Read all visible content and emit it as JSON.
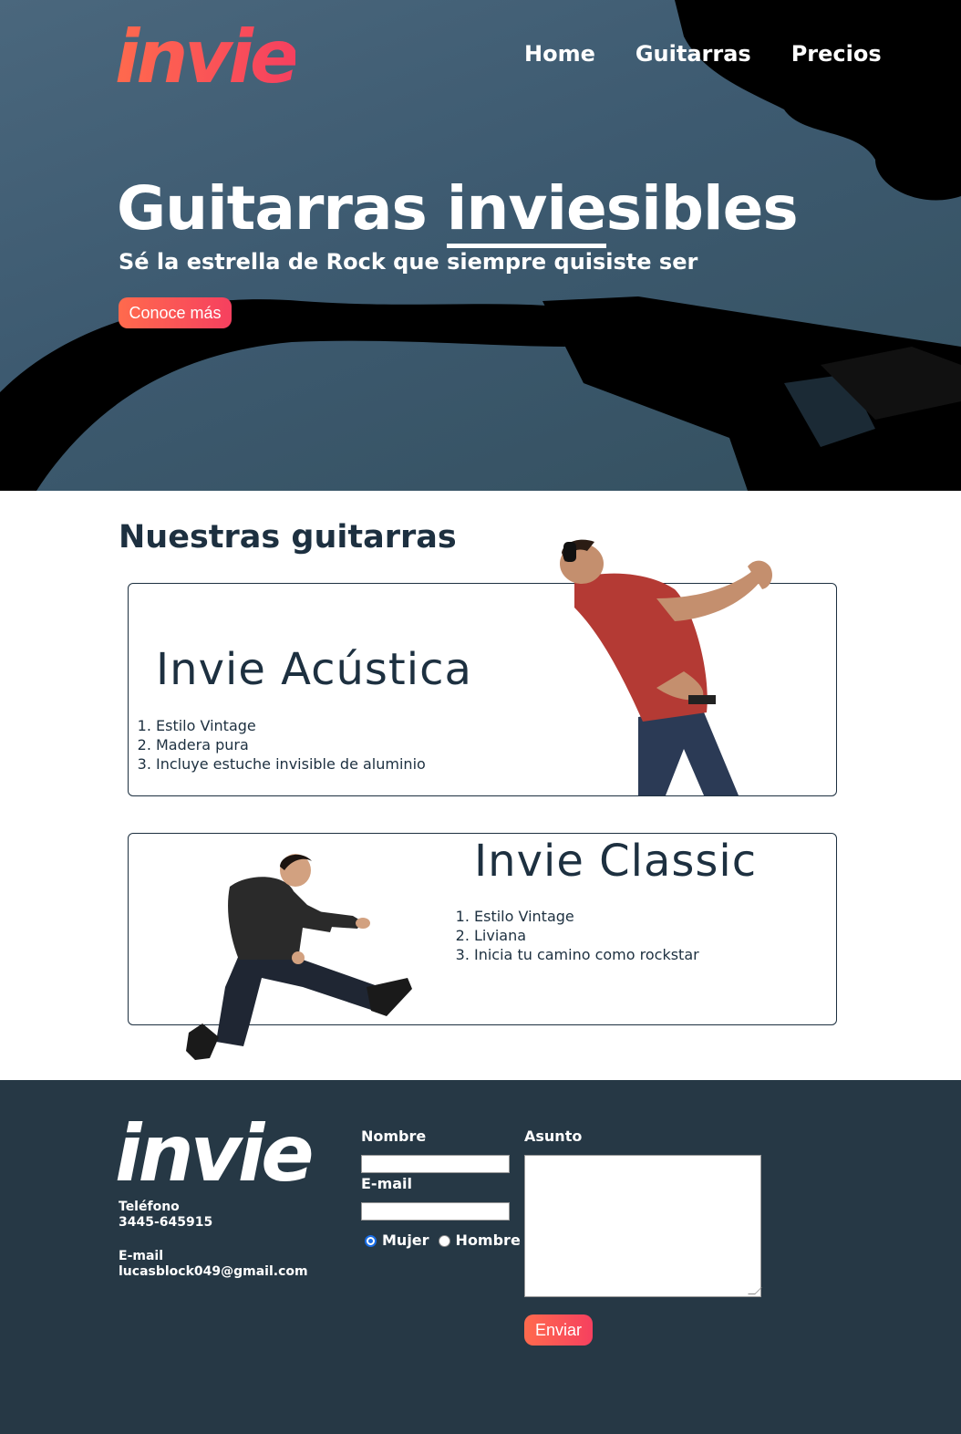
{
  "header": {
    "logo": "invie",
    "nav": [
      "Home",
      "Guitarras",
      "Precios"
    ]
  },
  "hero": {
    "title_before": "Guitarras ",
    "title_underlined": "invie",
    "title_after": "sibles",
    "subtitle": "Sé la estrella de Rock que siempre quisiste ser",
    "cta_label": "Conoce más"
  },
  "guitars": {
    "section_title": "Nuestras guitarras",
    "items": [
      {
        "name": "Invie Acústica",
        "features": [
          "Estilo Vintage",
          "Madera pura",
          "Incluye estuche invisible de aluminio"
        ]
      },
      {
        "name": "Invie Classic",
        "features": [
          "Estilo Vintage",
          "Liviana",
          "Inicia tu camino como rockstar"
        ]
      }
    ]
  },
  "footer": {
    "logo": "invie",
    "phone_label": "Teléfono",
    "phone": "3445-645915",
    "email_label": "E-mail",
    "email": "lucasblock049@gmail.com",
    "form": {
      "name_label": "Nombre",
      "email_label": "E-mail",
      "radio_female": "Mujer",
      "radio_male": "Hombre",
      "subject_label": "Asunto",
      "submit_label": "Enviar"
    }
  },
  "colors": {
    "accent_start": "#ff6a4d",
    "accent_end": "#f6405f",
    "dark": "#1d3040",
    "footer_bg": "#263845",
    "hero_bg": "#3d5a70"
  }
}
